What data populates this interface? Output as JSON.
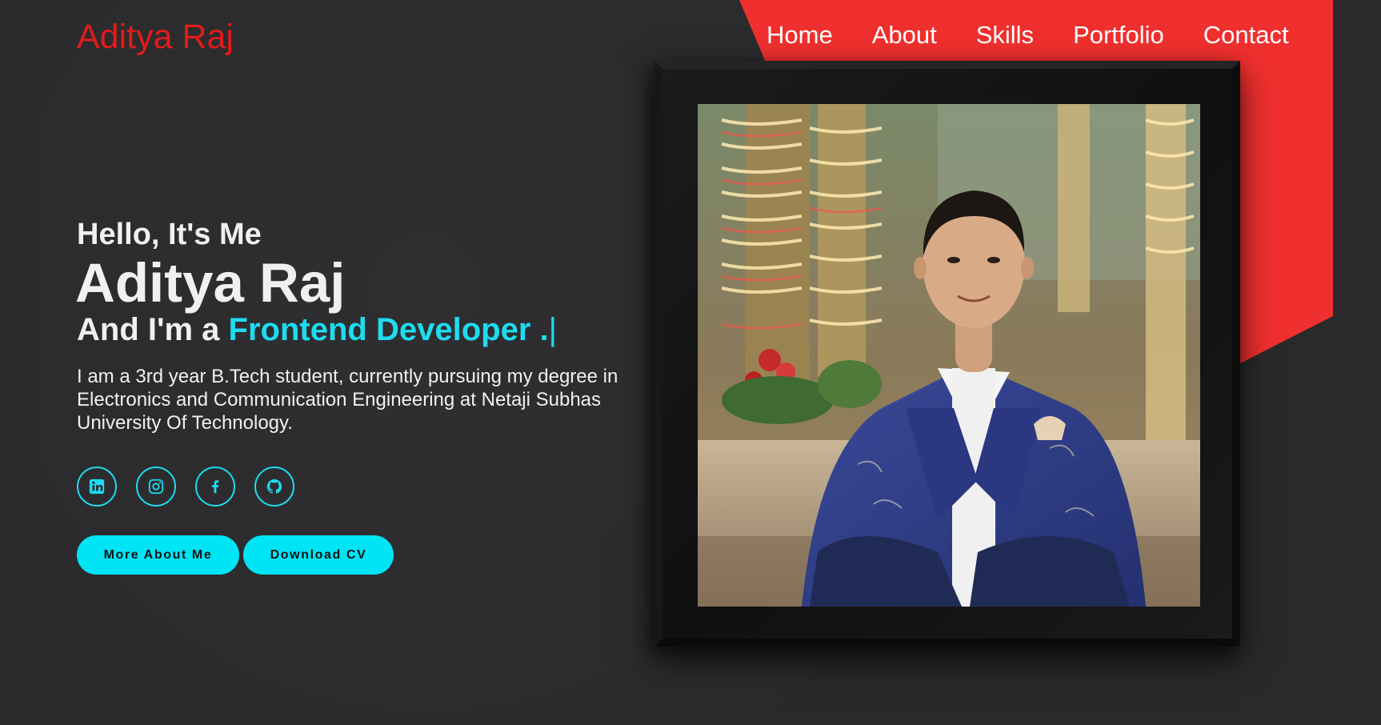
{
  "brand": {
    "name": "Aditya Raj",
    "color": "#e31b1b"
  },
  "nav": {
    "items": [
      {
        "label": "Home"
      },
      {
        "label": "About"
      },
      {
        "label": "Skills"
      },
      {
        "label": "Portfolio"
      },
      {
        "label": "Contact"
      }
    ]
  },
  "hero": {
    "greeting": "Hello, It's Me",
    "name": "Aditya Raj",
    "role_prefix": "And I'm a",
    "role_highlight": "Frontend Developer .",
    "cursor": "|",
    "description": "I am a 3rd year B.Tech student, currently pursuing my degree in Electronics and Communication Engineering at Netaji Subhas University Of Technology."
  },
  "socials": [
    {
      "icon": "linkedin-icon"
    },
    {
      "icon": "instagram-icon"
    },
    {
      "icon": "facebook-icon"
    },
    {
      "icon": "github-icon"
    }
  ],
  "buttons": {
    "more_about": "More About Me",
    "download_cv": "Download CV"
  },
  "colors": {
    "accent": "#1ddcf0",
    "button": "#00e5f5",
    "background": "#2a2a2c",
    "red_shape": "#f0302e"
  }
}
